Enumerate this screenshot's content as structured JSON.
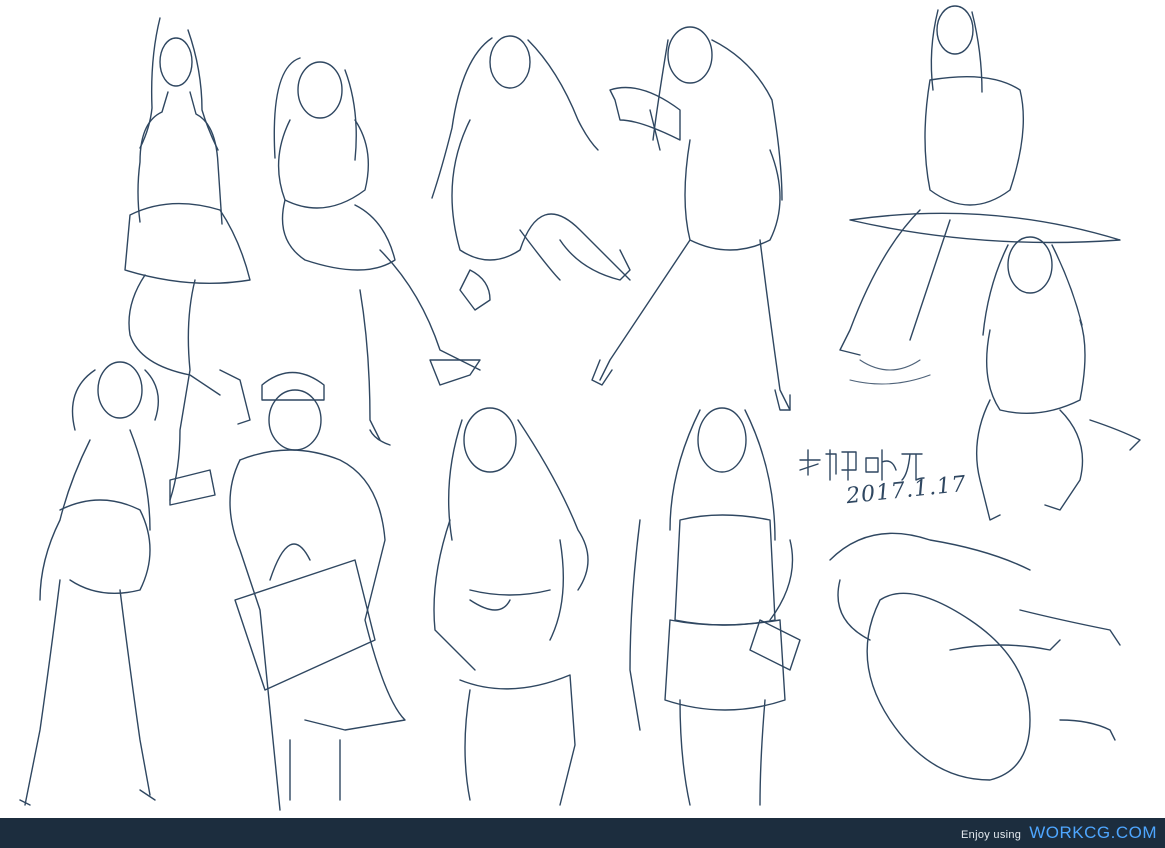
{
  "artwork": {
    "signature": {
      "date_text": "2017.1.17"
    },
    "line_color": "#2f4761",
    "background_color": "#ffffff"
  },
  "footer": {
    "prefix": "Enjoy using",
    "site": "WORKCG.COM",
    "background_color": "#1c2d3e",
    "site_color": "#4ea6ff"
  }
}
